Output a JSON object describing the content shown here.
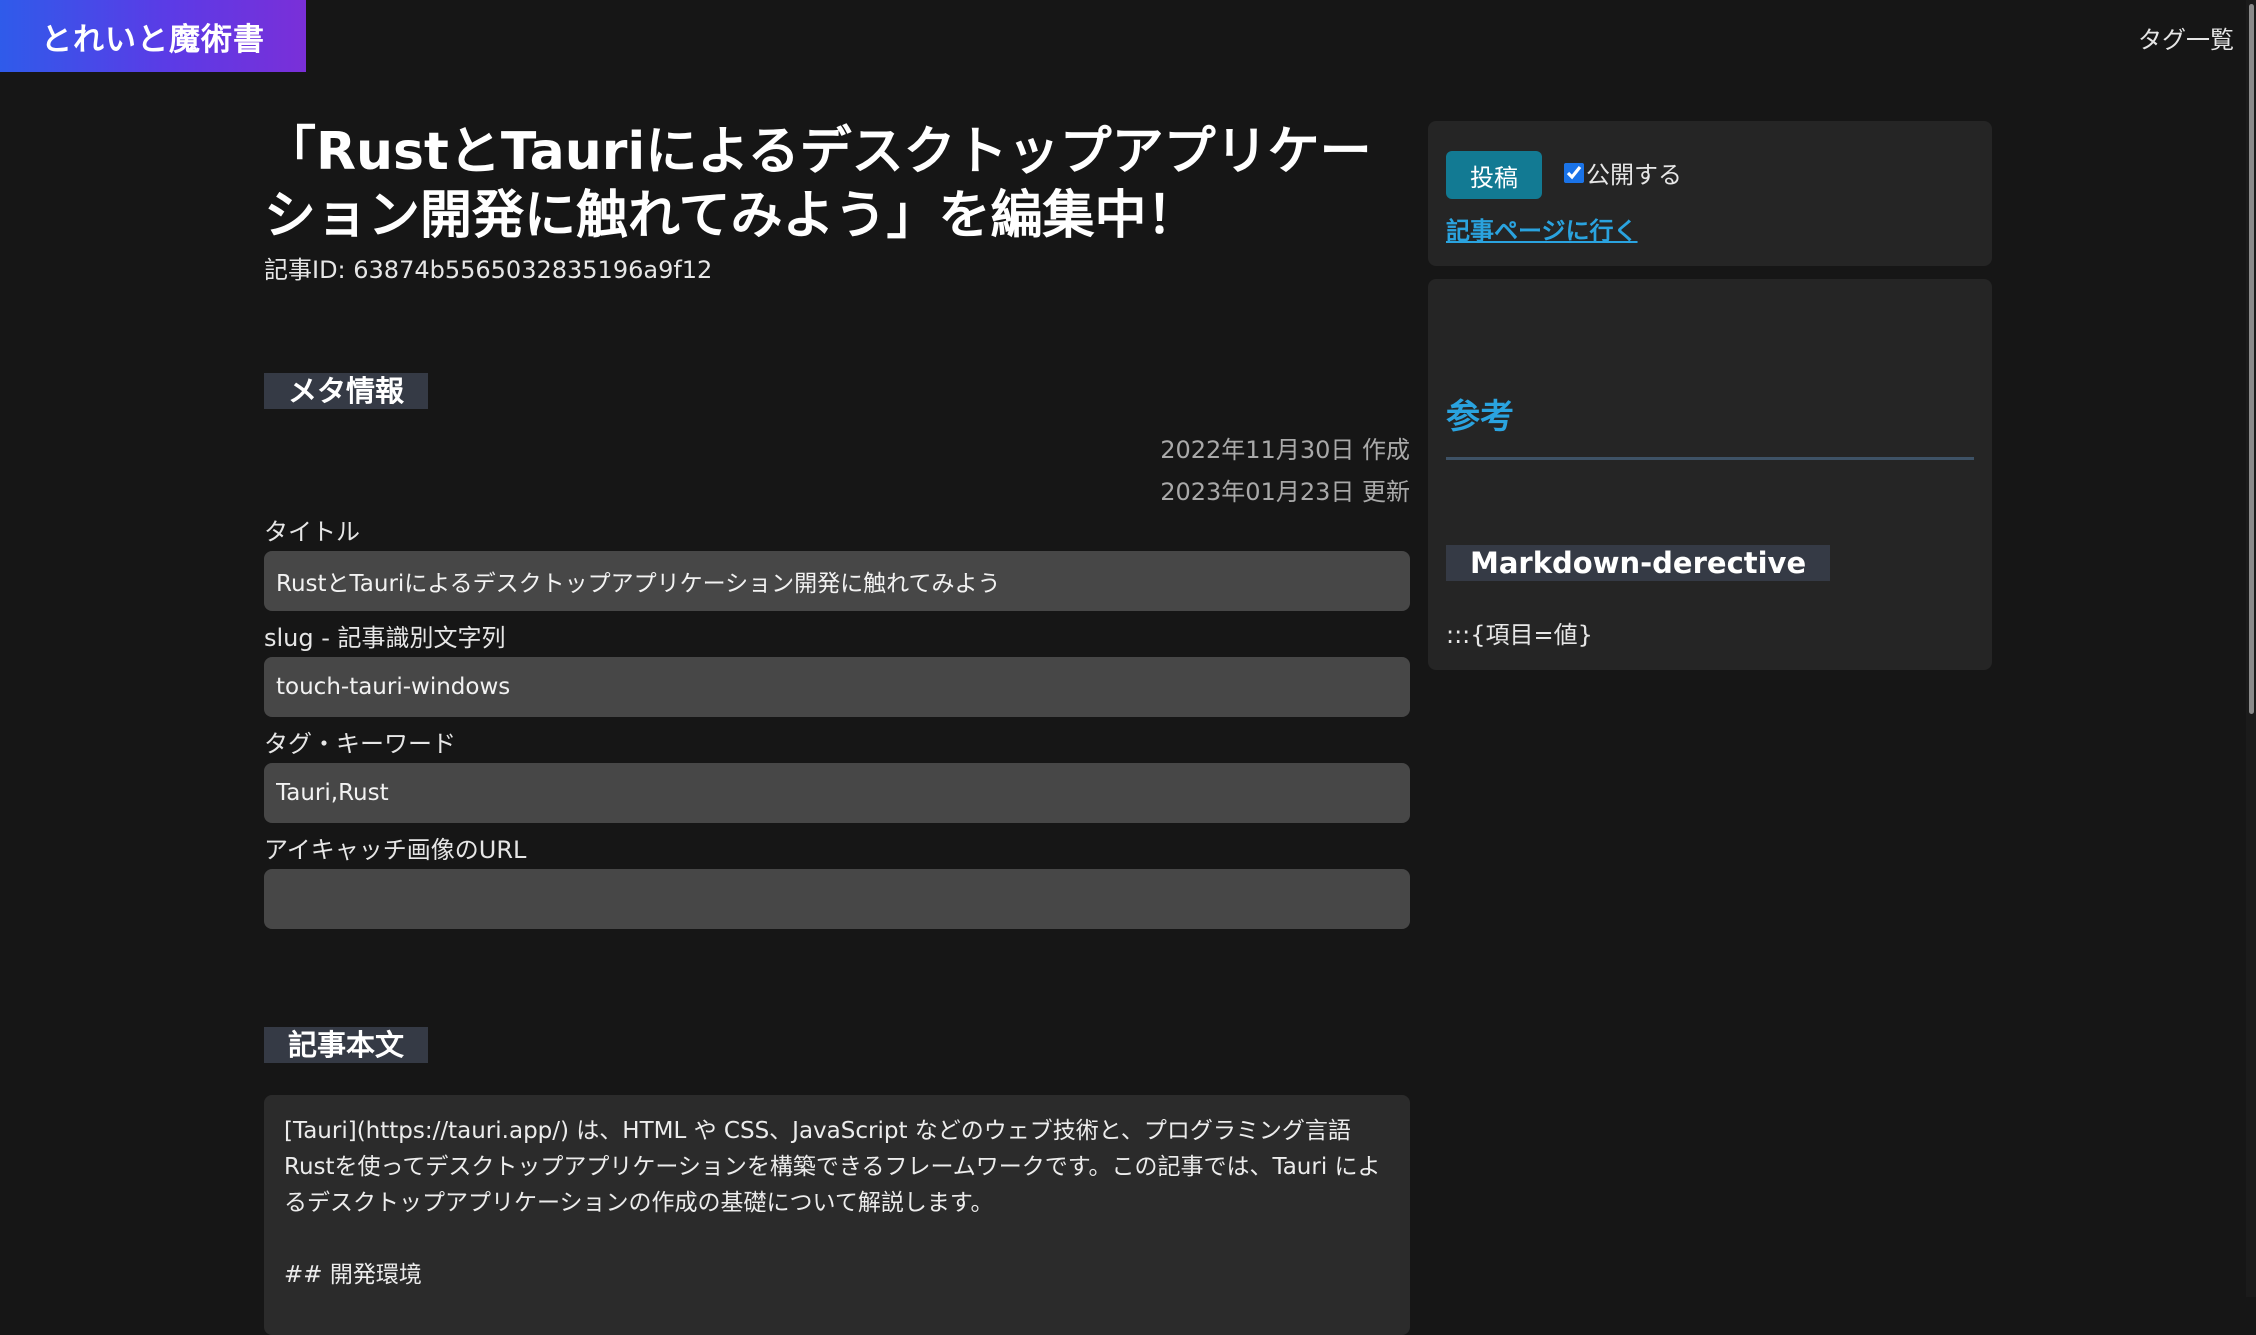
{
  "header": {
    "brand": "とれいと魔術書",
    "tag_list_link": "タグ一覧"
  },
  "editor": {
    "page_title": "「RustとTauriによるデスクトップアプリケーション開発に触れてみよう」を編集中！",
    "article_id": "記事ID: 63874b5565032835196a9f12",
    "meta_heading": "メタ情報",
    "created": "2022年11月30日  作成",
    "updated": "2023年01月23日  更新",
    "fields": {
      "title_label": "タイトル",
      "title_value": "RustとTauriによるデスクトップアプリケーション開発に触れてみよう",
      "slug_label": "slug - 記事識別文字列",
      "slug_value": "touch-tauri-windows",
      "tags_label": "タグ・キーワード",
      "tags_value": "Tauri,Rust",
      "eyecatch_label": "アイキャッチ画像のURL",
      "eyecatch_value": ""
    },
    "body_heading": "記事本文",
    "body_text": "[Tauri](https://tauri.app/) は、HTML や CSS、JavaScript などのウェブ技術と、プログラミング言語 Rustを使ってデスクトップアプリケーションを構築できるフレームワークです。この記事では、Tauri によるデスクトップアプリケーションの作成の基礎について解説します。\n\n## 開発環境"
  },
  "sidebar": {
    "post_button": "投稿",
    "publish_label": "公開する",
    "publish_checked": true,
    "article_page_link": "記事ページに行く",
    "reference_title": "参考",
    "reference_subheading": "Markdown-derective",
    "reference_code": ":::{項目=値}"
  },
  "colors": {
    "background": "#161616",
    "brand_gradient_start": "#2f5bea",
    "brand_gradient_end": "#7a2fd8",
    "accent_link": "#2aa3df",
    "post_button": "#127a93",
    "section_heading_bg": "#353a45",
    "input_bg": "#474747",
    "card_bg": "#252525"
  }
}
